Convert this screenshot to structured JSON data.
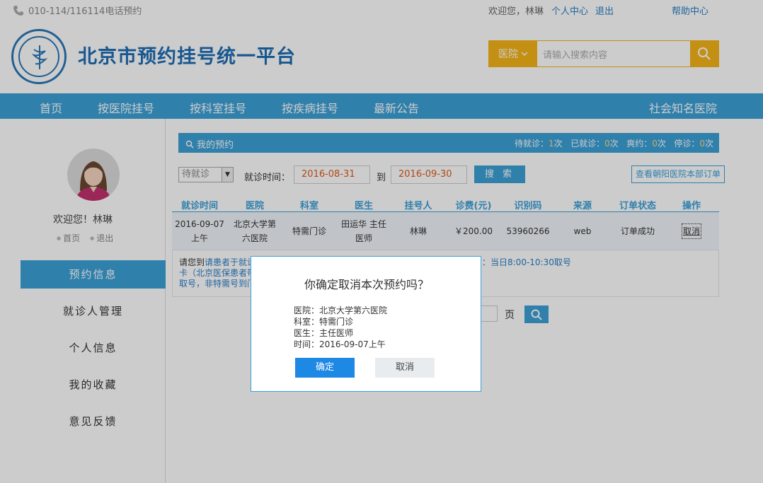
{
  "topbar": {
    "phone": "010-114/116114电话预约",
    "welcome": "欢迎您，林琳",
    "personal_center": "个人中心",
    "logout": "退出",
    "help": "帮助中心"
  },
  "header": {
    "site_title": "北京市预约挂号统一平台",
    "search_type": "医院",
    "search_placeholder": "请输入搜索内容"
  },
  "nav": {
    "items": [
      "首页",
      "按医院挂号",
      "按科室挂号",
      "按疾病挂号",
      "最新公告"
    ],
    "right_item": "社会知名医院"
  },
  "sidebar": {
    "greeting": "欢迎您！林琳",
    "home_link": "首页",
    "logout_link": "退出",
    "menu": [
      "预约信息",
      "就诊人管理",
      "个人信息",
      "我的收藏",
      "意见反馈"
    ]
  },
  "panel": {
    "title": "我的预约",
    "stats": {
      "waiting_label": "待就诊：",
      "waiting_count": "1",
      "visited_label": "已就诊：",
      "visited_count": "0",
      "missed_label": "爽约：",
      "missed_count": "0",
      "stopped_label": "停诊：",
      "stopped_count": "0",
      "unit": "次"
    }
  },
  "filter": {
    "status_value": "待就诊",
    "visit_time_label": "就诊时间：",
    "date_from": "2016-08-31",
    "to_label": "到",
    "date_to": "2016-09-30",
    "search_btn": "搜 索",
    "orders_btn": "查看朝阳医院本部订单"
  },
  "table": {
    "headers": [
      "就诊时间",
      "医院",
      "科室",
      "医生",
      "挂号人",
      "诊费(元)",
      "识别码",
      "来源",
      "订单状态",
      "操作"
    ],
    "row": {
      "time_line1": "2016-09-07",
      "time_line2": "上午",
      "hospital_line1": "北京大学第",
      "hospital_line2": "六医院",
      "department": "特需门诊",
      "doctor_line1": "田运华 主任",
      "doctor_line2": "医师",
      "patient": "林琳",
      "fee": "￥200.00",
      "code": "53960266",
      "source": "web",
      "status": "订单成功",
      "action": "取消"
    }
  },
  "notice": {
    "line1_prefix": "请您到",
    "line1_blue": "请患者于就诊",
    "line1_right": "：当日8:00-10:30取号",
    "line2": "卡（北京医保患者带",
    "line3": "取号，非特需号到门"
  },
  "pager": {
    "label": "页"
  },
  "dialog": {
    "question": "你确定取消本次预约吗？",
    "hospital": "医院：北京大学第六医院",
    "department": "科室：特需门诊",
    "doctor": "医生：主任医师",
    "time": "时间：2016-09-07上午",
    "confirm": "确定",
    "cancel": "取消"
  }
}
